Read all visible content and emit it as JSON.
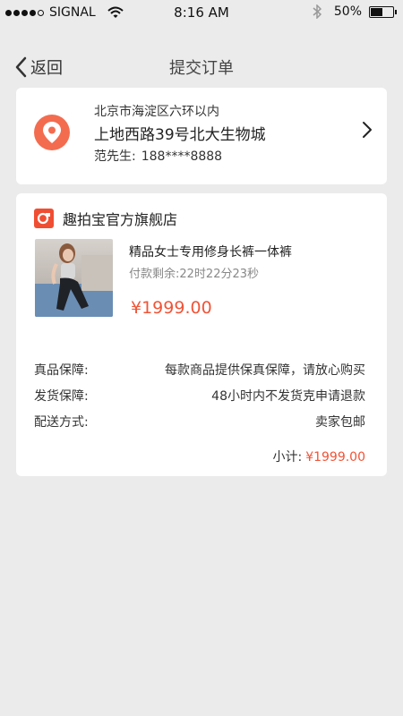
{
  "status_bar": {
    "carrier": "SIGNAL",
    "time": "8:16 AM",
    "battery_percent": "50%",
    "battery_level": 0.5
  },
  "nav": {
    "back_label": "返回",
    "title": "提交订单"
  },
  "address": {
    "line1": "北京市海淀区六环以内",
    "line2": "上地西路39号北大生物城",
    "name": "范先生:",
    "phone": "188****8888"
  },
  "order": {
    "shop_name": "趣拍宝官方旗舰店",
    "product_name": "精品女士专用修身长裤一体裤",
    "countdown": "付款剩余:22时22分23秒",
    "price": "¥1999.00",
    "rows": [
      {
        "label": "真品保障:",
        "value": "每款商品提供保真保障，请放心购买"
      },
      {
        "label": "发货保障:",
        "value": "48小时内不发货克申请退款"
      },
      {
        "label": "配送方式:",
        "value": "卖家包邮"
      }
    ],
    "subtotal_label": "小计:",
    "subtotal_value": "¥1999.00"
  },
  "colors": {
    "accent": "#f05437",
    "location_icon": "#f36c4f",
    "shop_logo": "#f04e32",
    "background": "#ebebeb"
  },
  "icons": [
    "signal-dots-icon",
    "wifi-icon",
    "bluetooth-icon",
    "battery-icon",
    "back-chevron-icon",
    "location-pin-icon",
    "chevron-right-icon",
    "shop-logo-icon"
  ]
}
